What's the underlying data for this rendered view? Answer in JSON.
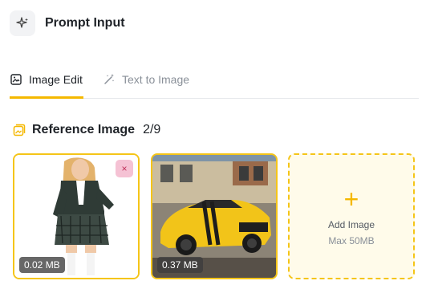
{
  "header": {
    "title": "Prompt Input",
    "icon": "sparkle-icon"
  },
  "tabs": [
    {
      "label": "Image Edit",
      "icon": "image-edit-icon",
      "active": true
    },
    {
      "label": "Text to Image",
      "icon": "magic-wand-icon",
      "active": false
    }
  ],
  "reference": {
    "title": "Reference Image",
    "count": "2/9",
    "icon": "image-gallery-icon",
    "images": [
      {
        "size": "0.02 MB",
        "depicts": "person-in-school-uniform",
        "remove_label": "×"
      },
      {
        "size": "0.37 MB",
        "depicts": "yellow-sports-car",
        "remove_label": "×"
      }
    ],
    "add": {
      "plus": "+",
      "label": "Add Image",
      "sub": "Max 50MB"
    }
  },
  "colors": {
    "accent": "#f5b800",
    "border": "#f5c518",
    "text": "#1f2328",
    "muted": "#8a9099"
  }
}
